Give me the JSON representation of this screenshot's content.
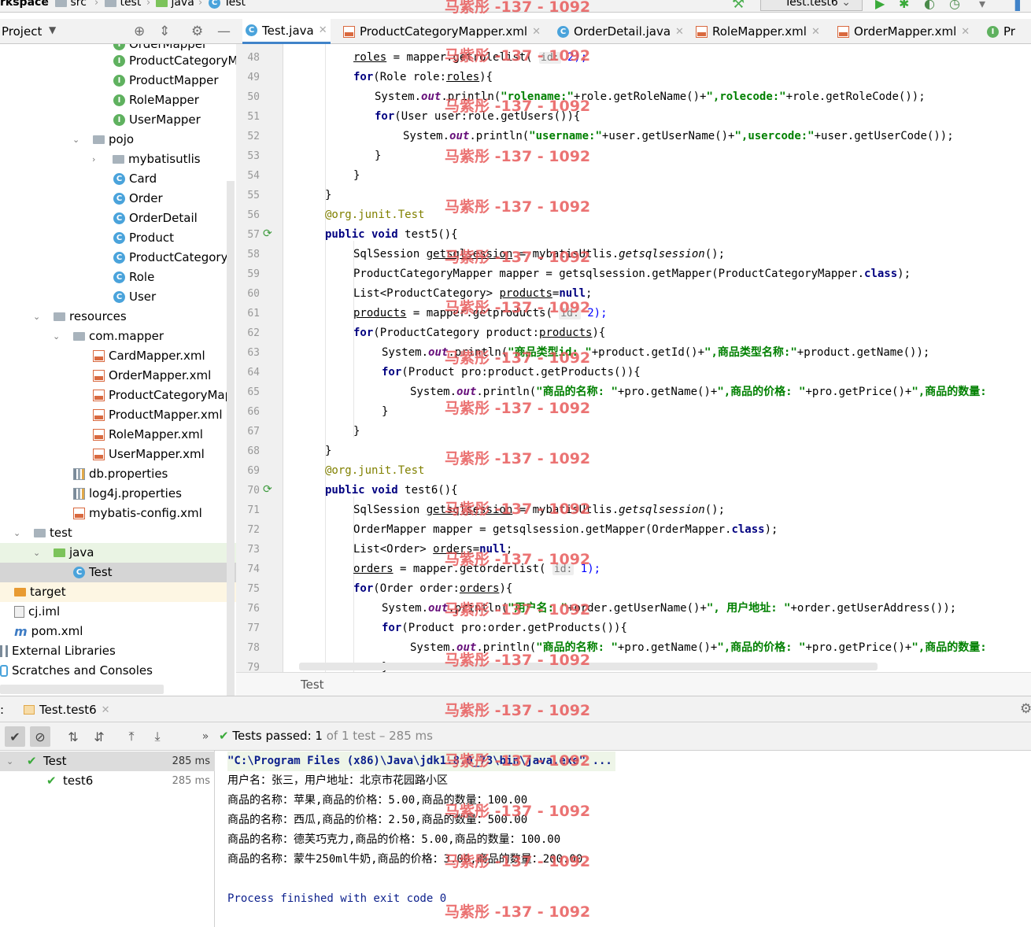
{
  "breadcrumb": [
    "rkspace",
    "src",
    "test",
    "java",
    "Test"
  ],
  "run_config": "Test.test6",
  "project_header": {
    "label": "Project"
  },
  "editor_tabs": [
    {
      "label": "Test.java",
      "active": true
    },
    {
      "label": "ProductCategoryMapper.xml"
    },
    {
      "label": "OrderDetail.java"
    },
    {
      "label": "RoleMapper.xml"
    },
    {
      "label": "OrderMapper.xml"
    },
    {
      "label": "Pr"
    }
  ],
  "tree": [
    {
      "label": "OrderMapper",
      "icon": "interface-icon"
    },
    {
      "label": "ProductCategoryM",
      "icon": "interface-icon"
    },
    {
      "label": "ProductMapper",
      "icon": "interface-icon"
    },
    {
      "label": "RoleMapper",
      "icon": "interface-icon"
    },
    {
      "label": "UserMapper",
      "icon": "interface-icon"
    },
    {
      "label": "pojo",
      "icon": "package-icon"
    },
    {
      "label": "mybatisutlis",
      "icon": "package-icon"
    },
    {
      "label": "Card",
      "icon": "class-icon"
    },
    {
      "label": "Order",
      "icon": "class-icon"
    },
    {
      "label": "OrderDetail",
      "icon": "class-icon"
    },
    {
      "label": "Product",
      "icon": "class-icon"
    },
    {
      "label": "ProductCategory",
      "icon": "class-icon"
    },
    {
      "label": "Role",
      "icon": "class-icon"
    },
    {
      "label": "User",
      "icon": "class-icon"
    },
    {
      "label": "resources",
      "icon": "folder-icon"
    },
    {
      "label": "com.mapper",
      "icon": "folder-icon"
    },
    {
      "label": "CardMapper.xml",
      "icon": "xml-icon"
    },
    {
      "label": "OrderMapper.xml",
      "icon": "xml-icon"
    },
    {
      "label": "ProductCategoryMap",
      "icon": "xml-icon"
    },
    {
      "label": "ProductMapper.xml",
      "icon": "xml-icon"
    },
    {
      "label": "RoleMapper.xml",
      "icon": "xml-icon"
    },
    {
      "label": "UserMapper.xml",
      "icon": "xml-icon"
    },
    {
      "label": "db.properties",
      "icon": "properties-icon"
    },
    {
      "label": "log4j.properties",
      "icon": "properties-icon"
    },
    {
      "label": "mybatis-config.xml",
      "icon": "xml-icon"
    },
    {
      "label": "test",
      "icon": "folder-icon"
    },
    {
      "label": "java",
      "icon": "folder-icon"
    },
    {
      "label": "Test",
      "icon": "class-icon"
    },
    {
      "label": "target",
      "icon": "folder-icon"
    },
    {
      "label": "cj.iml",
      "icon": "file-icon"
    },
    {
      "label": "pom.xml",
      "icon": "maven-icon"
    },
    {
      "label": "External Libraries",
      "icon": "library-icon"
    },
    {
      "label": "Scratches and Consoles",
      "icon": "scratch-icon"
    }
  ],
  "line_numbers": [
    "48",
    "49",
    "50",
    "51",
    "52",
    "53",
    "54",
    "55",
    "56",
    "57",
    "58",
    "59",
    "60",
    "61",
    "62",
    "63",
    "64",
    "65",
    "66",
    "67",
    "68",
    "69",
    "70",
    "71",
    "72",
    "73",
    "74",
    "75",
    "76",
    "77",
    "78",
    "79"
  ],
  "code": {
    "l48": {
      "a": "roles",
      "b": " = mapper.getrolelist( ",
      "h": "id:",
      "c": " 2);"
    },
    "l49": {
      "a": "for",
      "b": "(Role role:",
      "c": "roles",
      "d": "){"
    },
    "l50": {
      "a": "System.",
      "b": "out",
      "c": ".println(",
      "d": "\"rolename:\"",
      "e": "+role.getRoleName()+",
      "f": "\",rolecode:\"",
      "g": "+role.getRoleCode());"
    },
    "l51": {
      "a": "for",
      "b": "(User user:role.getUsers()){"
    },
    "l52": {
      "a": "System.",
      "b": "out",
      "c": ".println(",
      "d": "\"username:\"",
      "e": "+user.getUserName()+",
      "f": "\",usercode:\"",
      "g": "+user.getUserCode());"
    },
    "l53": "}",
    "l54": "}",
    "l55": "}",
    "l56": {
      "a": "@org.junit.",
      "b": "Test"
    },
    "l57": {
      "a": "public void",
      "b": " test5(){"
    },
    "l58": {
      "a": "SqlSession ",
      "b": "getsqlsession",
      "c": " = mybatisUtlis.",
      "d": "getsqlsession",
      "e": "();"
    },
    "l59": {
      "a": "ProductCategoryMapper mapper = getsqlsession.getMapper(ProductCategoryMapper.",
      "b": "class",
      "c": ");"
    },
    "l60": {
      "a": "List<ProductCategory> ",
      "b": "products",
      "c": "=",
      "d": "null",
      "e": ";"
    },
    "l61": {
      "a": "products",
      "b": " = mapper.getproducts( ",
      "h": "id:",
      "c": " 2);"
    },
    "l62": {
      "a": "for",
      "b": "(ProductCategory product:",
      "c": "products",
      "d": "){"
    },
    "l63": {
      "a": "System.",
      "b": "out",
      "c": ".println(",
      "d": "\"商品类型id: \"",
      "e": "+product.getId()+",
      "f": "\",商品类型名称:\"",
      "g": "+product.getName());"
    },
    "l64": {
      "a": "for",
      "b": "(Product pro:product.getProducts()){"
    },
    "l65": {
      "a": "System.",
      "b": "out",
      "c": ".println(",
      "d": "\"商品的名称: \"",
      "e": "+pro.getName()+",
      "f": "\",商品的价格: \"",
      "g": "+pro.getPrice()+",
      "i": "\",商品的数量:"
    },
    "l66": "}",
    "l67": "}",
    "l68": "}",
    "l69": {
      "a": "@org.junit.",
      "b": "Test"
    },
    "l70": {
      "a": "public void",
      "b": " test6(){"
    },
    "l71": {
      "a": "SqlSession ",
      "b": "getsqlsession",
      "c": " = mybatisUtlis.",
      "d": "getsqlsession",
      "e": "();"
    },
    "l72": {
      "a": "OrderMapper mapper = getsqlsession.getMapper(OrderMapper.",
      "b": "class",
      "c": ");"
    },
    "l73": {
      "a": "List<Order> ",
      "b": "orders",
      "c": "=",
      "d": "null",
      "e": ";"
    },
    "l74": {
      "a": "orders",
      "b": " = mapper.getorderlist( ",
      "h": "id:",
      "c": " 1);"
    },
    "l75": {
      "a": "for",
      "b": "(Order order:",
      "c": "orders",
      "d": "){"
    },
    "l76": {
      "a": "System.",
      "b": "out",
      "c": ".println(",
      "d": "\"用户名: \"",
      "e": "+order.getUserName()+",
      "f": "\", 用户地址: \"",
      "g": "+order.getUserAddress());"
    },
    "l77": {
      "a": "for",
      "b": "(Product pro:order.getProducts()){"
    },
    "l78": {
      "a": "System.",
      "b": "out",
      "c": ".println(",
      "d": "\"商品的名称: \"",
      "e": "+pro.getName()+",
      "f": "\",商品的价格: \"",
      "g": "+pro.getPrice()+",
      "i": "\",商品的数量:"
    },
    "l79": "}"
  },
  "editor_breadcrumb": "Test",
  "run_tab": {
    "label": "Test.test6",
    "prefix": ":"
  },
  "test_status": {
    "title": "Tests passed:",
    "count": "1",
    "rest": "of 1 test – 285 ms"
  },
  "test_tree": [
    {
      "label": "Test",
      "time": "285 ms"
    },
    {
      "label": "test6",
      "time": "285 ms"
    }
  ],
  "console": {
    "cmd": "\"C:\\Program Files (x86)\\Java\\jdk1.8.0_73\\bin\\java.exe\" ...",
    "lines": [
      "用户名：张三，用户地址：北京市花园路小区",
      "商品的名称：苹果,商品的价格：5.00,商品的数量：100.00",
      "商品的名称：西瓜,商品的价格：2.50,商品的数量：500.00",
      "商品的名称：德芙巧克力,商品的价格：5.00,商品的数量：100.00",
      "商品的名称：蒙牛250ml牛奶,商品的价格：3.00,商品的数量：200.00"
    ],
    "exit": "Process finished with exit code 0"
  },
  "watermark": "马紫彤 -137 - 1092",
  "colors": {
    "accent": "#4083c9",
    "pass": "#3aaa3a",
    "keyword": "#000080",
    "string": "#008000",
    "watermark": "#e85a5a"
  }
}
